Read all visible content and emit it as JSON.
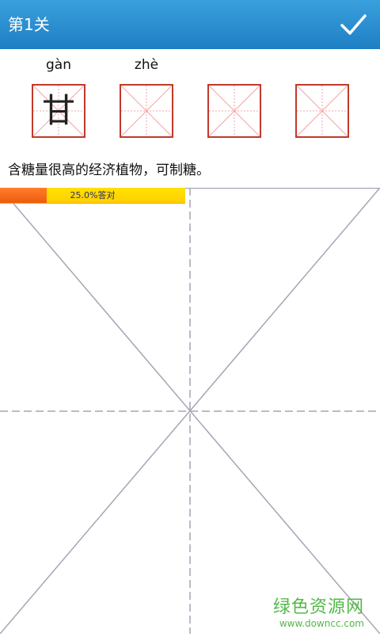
{
  "header": {
    "title": "第1关",
    "confirm_icon": "checkmark-icon"
  },
  "characters": [
    {
      "pinyin": "gàn",
      "char": "甘"
    },
    {
      "pinyin": "zhè",
      "char": ""
    },
    {
      "pinyin": "",
      "char": ""
    },
    {
      "pinyin": "",
      "char": ""
    }
  ],
  "hint": "含糖量很高的经济植物，可制糖。",
  "progress": {
    "label": "25.0%答对",
    "fraction": 0.25
  },
  "watermark": {
    "line1": "绿色资源网",
    "line2": "www.downcc.com"
  },
  "colors": {
    "header": "#1e7fc3",
    "grid_border": "#c0392b",
    "grid_guides": "#f2a3a3",
    "canvas_lines": "#a7a4b6",
    "progress_fill": "#ee5c10",
    "progress_bg": "#ffd500"
  }
}
